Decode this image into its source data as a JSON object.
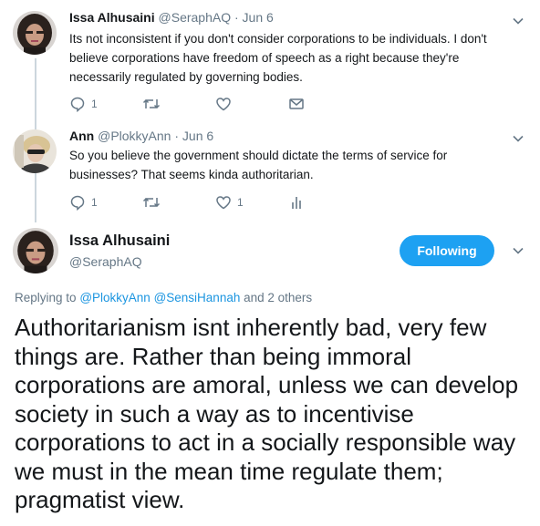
{
  "tweet1": {
    "name": "Issa Alhusaini",
    "handle": "@SeraphAQ",
    "date": "· Jun 6",
    "text": "Its not inconsistent if you don't consider corporations to be individuals. I don't believe corporations have freedom of speech as a right because they're necessarily regulated by governing bodies.",
    "reply_count": "1",
    "retweet_count": "",
    "like_count": ""
  },
  "tweet2": {
    "name": "Ann",
    "handle": "@PlokkyAnn",
    "date": "· Jun 6",
    "text": "So you believe the government should dictate the terms of service for businesses? That seems kinda authoritarian.",
    "reply_count": "1",
    "retweet_count": "",
    "like_count": "1"
  },
  "main_tweet": {
    "name": "Issa Alhusaini",
    "handle": "@SeraphAQ",
    "follow_label": "Following",
    "replying_prefix": "Replying to",
    "mention1": "@PlokkyAnn",
    "mention2": "@SensiHannah",
    "replying_suffix": "and 2 others",
    "text": "Authoritarianism isnt inherently bad, very few things are. Rather than being immoral corporations are amoral, unless we can develop society in such a way as to incentivise corporations to act in a socially responsible way we must in the mean time regulate them; pragmatist view."
  },
  "colors": {
    "accent": "#1da1f2",
    "mention": "#1b95e0",
    "secondary_text": "#657786",
    "thread_line": "#ccd6dd"
  },
  "icons": {
    "reply": "reply-icon",
    "retweet": "retweet-icon",
    "like": "heart-icon",
    "dm": "envelope-icon",
    "analytics": "analytics-icon",
    "more": "chevron-down-icon"
  }
}
